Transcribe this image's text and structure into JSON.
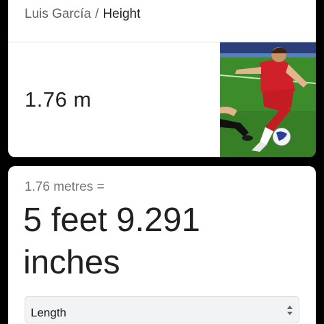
{
  "knowledge_panel": {
    "breadcrumb": {
      "entity": "Luis García",
      "separator": "/",
      "attribute": "Height"
    },
    "value": "1.76 m",
    "image_description": "photo-soccer-player"
  },
  "converter": {
    "source_text": "1.76 metres =",
    "result_text": "5 feet 9.291 inches",
    "unit_type": "Length"
  },
  "colors": {
    "background": "#000000",
    "card": "#ffffff",
    "text_primary": "#202124",
    "text_secondary": "#70757a",
    "select_bg": "#f1f3f4"
  }
}
